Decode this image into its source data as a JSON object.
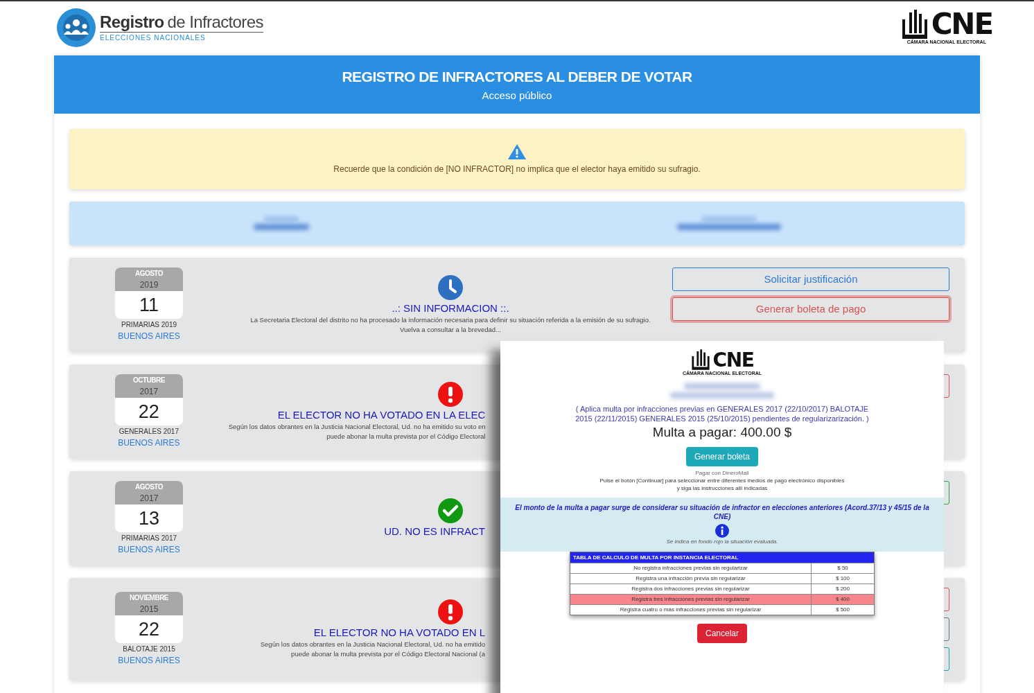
{
  "header": {
    "brand_bold": "Registro",
    "brand_rest": "de Infractores",
    "brand_sub": "ELECCIONES NACIONALES",
    "logo_title": "CNE",
    "logo_sub": "CÁMARA NACIONAL ELECTORAL"
  },
  "banner": {
    "title": "REGISTRO DE INFRACTORES AL DEBER DE VOTAR",
    "subtitle": "Acceso público"
  },
  "warning": {
    "text": "Recuerde que la condición de [NO INFRACTOR] no implica que el elector haya emitido su sufragio."
  },
  "records": [
    {
      "month": "AGOSTO",
      "year": "2019",
      "day": "11",
      "election": "PRIMARIAS 2019",
      "district": "BUENOS AIRES",
      "kind": "pending",
      "clipped": false,
      "title": "..: SIN INFORMACION ::.",
      "lines": [
        "La Secretaria Electoral del distrito no ha procesado la información necesaria para definir su situación referida a la emisión de su sufragio.",
        "Vuelva a consultar a la brevedad..."
      ],
      "buttons": [
        {
          "kind": "primary",
          "label": "Solicitar justificación",
          "focused": false
        },
        {
          "kind": "danger",
          "label": "Generar boleta de pago",
          "focused": true
        }
      ]
    },
    {
      "month": "OCTUBRE",
      "year": "2017",
      "day": "22",
      "election": "GENERALES 2017",
      "district": "BUENOS AIRES",
      "kind": "infractor",
      "clipped": true,
      "title": "EL ELECTOR NO HA VOTADO EN LA ELEC",
      "lines": [
        "Según los datos obrantes en la Justicia Nacional Electoral, Ud. no ha emitido su voto en",
        "puede abonar la multa prevista por el Código Electoral"
      ],
      "buttons": [
        {
          "kind": "danger"
        }
      ]
    },
    {
      "month": "AGOSTO",
      "year": "2017",
      "day": "13",
      "election": "PRIMARIAS 2017",
      "district": "BUENOS AIRES",
      "kind": "ok",
      "clipped": true,
      "title": "UD. NO ES INFRACT",
      "buttons": [
        {
          "kind": "success"
        }
      ]
    },
    {
      "month": "NOVIEMBRE",
      "year": "2015",
      "day": "22",
      "election": "BALOTAJE 2015",
      "district": "BUENOS AIRES",
      "kind": "infractor",
      "clipped": true,
      "title": "EL ELECTOR NO HA VOTADO EN L",
      "lines": [
        "Según los datos obrantes en la Justicia Nacional Electoral, Ud. no ha emitido",
        "puede abonar la multa prevista por el Código Electoral Nacional (a"
      ],
      "buttons": [
        {
          "kind": "danger"
        },
        {
          "kind": "secondary"
        },
        {
          "kind": "info"
        }
      ]
    }
  ],
  "modal": {
    "logo_title": "CNE",
    "logo_sub": "CÁMARA NACIONAL ELECTORAL",
    "note": "( Aplica multa por infracciones previas en GENERALES 2017 (22/10/2017) BALOTAJE 2015 (22/11/2015) GENERALES 2015 (25/10/2015) pendientes de regularizarización. )",
    "amount": "Multa a pagar: 400.00 $",
    "generate_button": "Generar boleta",
    "image_alt": "Pagar con DineroMail",
    "instructions": [
      "Pulse el botón [Continuar] para seleccionar entre diferentes medios de pago electrónico disponibles",
      "y siga las instrucciones allí indicadas"
    ],
    "explanation": "El monto de la multa a pagar surge de considerar su situación de infractor en elecciones anteriores (Acord.37/13 y 45/15 de la CNE)",
    "hint": "Se indica en fondo rojo la situación evaluada.",
    "table": {
      "title": "TABLA DE CALCULO DE MULTA POR INSTANCIA ELECTORAL",
      "rows": [
        {
          "label": "No registra infracciones previas sin regularizar",
          "amount": "$ 50",
          "selected": false
        },
        {
          "label": "Registra una infracción previa sin regularizar",
          "amount": "$ 100",
          "selected": false
        },
        {
          "label": "Registra dos infracciones previas sin regularizar",
          "amount": "$ 200",
          "selected": false
        },
        {
          "label": "Registra tres infracciones previas sin regularizar",
          "amount": "$ 400",
          "selected": true
        },
        {
          "label": "Registra cuatro o más infracciones previas sin regularizar",
          "amount": "$ 500",
          "selected": false
        }
      ]
    },
    "cancel_button": "Cancelar"
  }
}
